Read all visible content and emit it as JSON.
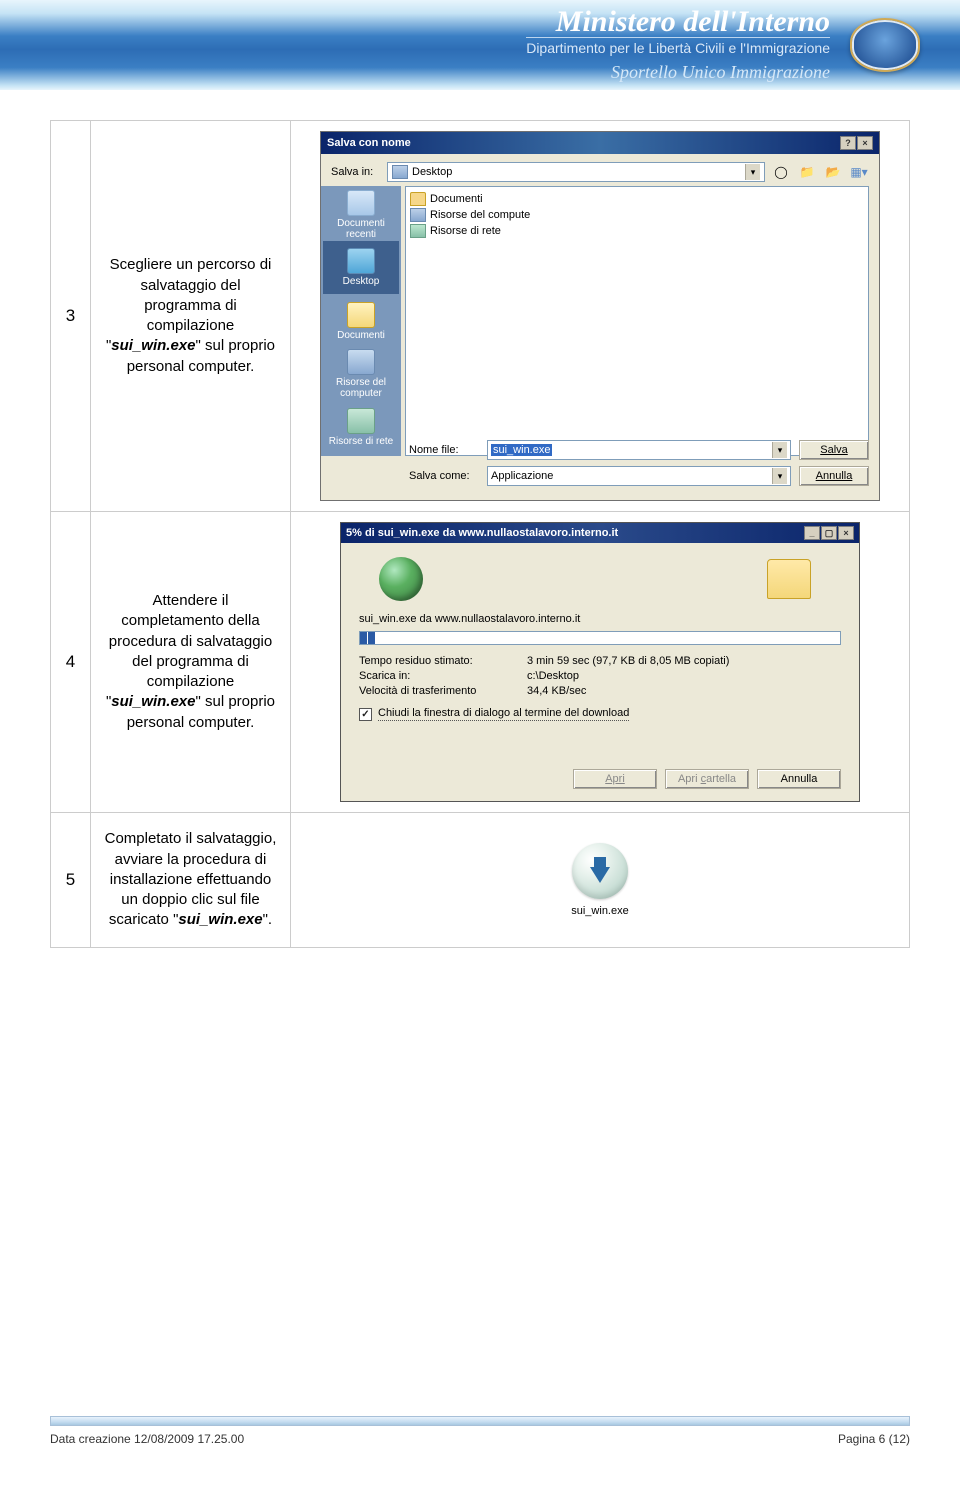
{
  "header": {
    "title": "Ministero dell'Interno",
    "subtitle": "Dipartimento per le Libertà Civili e l'Immigrazione",
    "subtitle2": "Sportello Unico Immigrazione"
  },
  "rows": [
    {
      "num": "3",
      "desc_pre": "Scegliere un percorso di salvataggio del programma di compilazione \"",
      "file": "sui_win.exe",
      "desc_post": "\" sul proprio personal computer."
    },
    {
      "num": "4",
      "desc_pre": "Attendere il completamento della procedura di salvataggio del programma di compilazione \"",
      "file": "sui_win.exe",
      "desc_post": "\" sul proprio personal computer."
    },
    {
      "num": "5",
      "desc_pre": "Completato il salvataggio, avviare la procedura di installazione effettuando un doppio clic sul file scaricato \"",
      "file": "sui_win.exe",
      "desc_post": "\"."
    }
  ],
  "save_dialog": {
    "title": "Salva con nome",
    "save_in_label": "Salva in:",
    "save_in_value": "Desktop",
    "places": [
      "Documenti recenti",
      "Desktop",
      "Documenti",
      "Risorse del computer",
      "Risorse di rete"
    ],
    "list_items": [
      "Documenti",
      "Risorse del compute",
      "Risorse di rete"
    ],
    "filename_label": "Nome file:",
    "filename_value": "sui_win.exe",
    "savetype_label": "Salva come:",
    "savetype_value": "Applicazione",
    "btn_save": "Salva",
    "btn_cancel": "Annulla"
  },
  "dl_dialog": {
    "title": "5% di sui_win.exe da www.nullaostalavoro.interno.it",
    "file_from": "sui_win.exe da  www.nullaostalavoro.interno.it",
    "time_label": "Tempo residuo stimato:",
    "time_value": "3 min 59 sec (97,7 KB di 8,05 MB copiati)",
    "dest_label": "Scarica in:",
    "dest_value": "c:\\Desktop",
    "rate_label": "Velocità di trasferimento",
    "rate_value": "34,4 KB/sec",
    "checkbox": "Chiudi la finestra di dialogo al termine del download",
    "btn_open": "Apri",
    "btn_openfolder_pre": "Apri ",
    "btn_openfolder_ul": "c",
    "btn_openfolder_post": "artella",
    "btn_cancel": "Annulla"
  },
  "row5_icon_label": "sui_win.exe",
  "footer": {
    "left": "Data creazione 12/08/2009 17.25.00",
    "right": "Pagina 6 (12)"
  }
}
